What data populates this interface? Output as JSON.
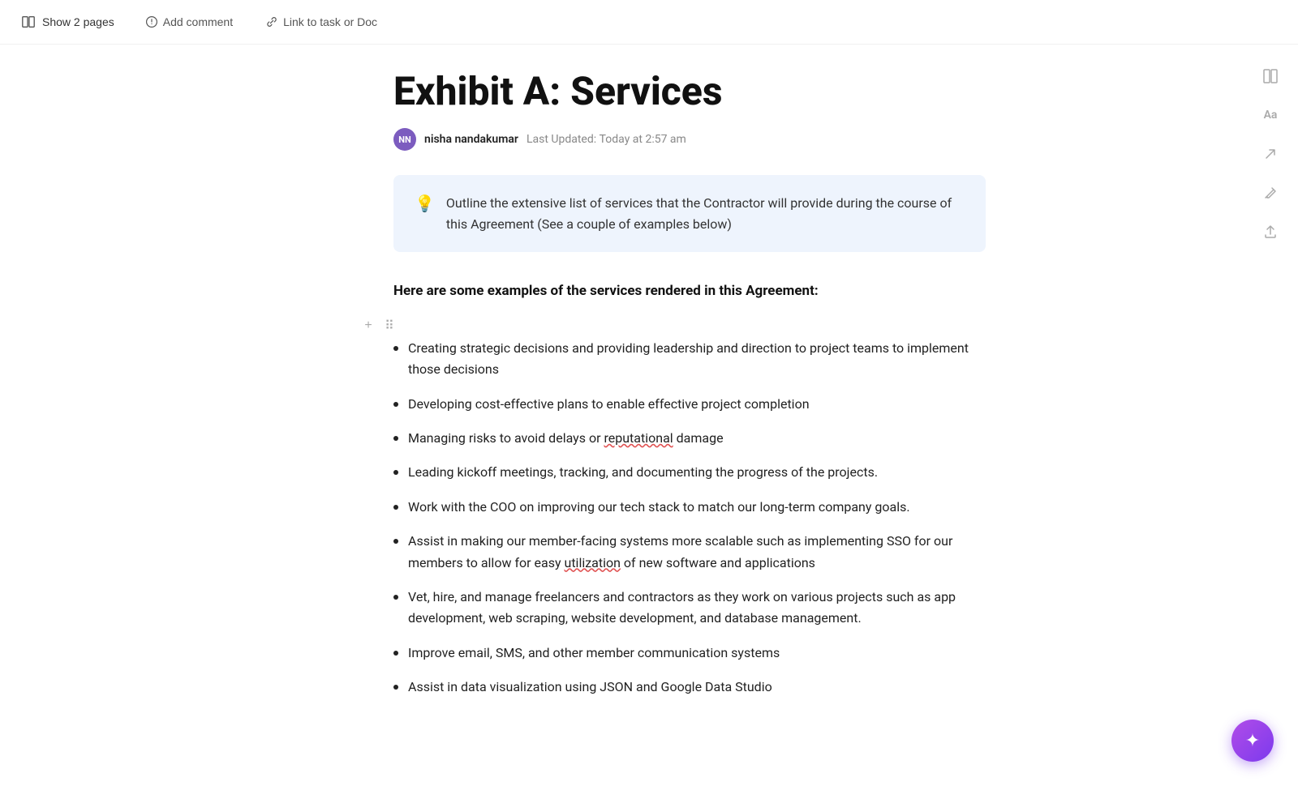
{
  "toolbar": {
    "show_pages_label": "Show 2 pages",
    "add_comment_label": "Add comment",
    "link_task_label": "Link to task or Doc"
  },
  "right_sidebar": {
    "icons": [
      {
        "name": "layout-icon",
        "symbol": "⊞"
      },
      {
        "name": "font-icon",
        "symbol": "Aa"
      },
      {
        "name": "share-icon",
        "symbol": "↗"
      },
      {
        "name": "edit-icon",
        "symbol": "✎"
      },
      {
        "name": "export-icon",
        "symbol": "↑"
      }
    ]
  },
  "document": {
    "title": "Exhibit A: Services",
    "author": {
      "initials": "NN",
      "name": "nisha nandakumar",
      "last_updated_label": "Last Updated:",
      "last_updated_value": "Today at 2:57 am"
    },
    "callout": {
      "icon": "💡",
      "text": "Outline the extensive list of services that the Contractor will provide during the course of this Agreement (See a couple of examples below)"
    },
    "section_heading": "Here are some examples of the services rendered in this Agreement:",
    "bullet_items": [
      {
        "id": 1,
        "text": "Creating strategic decisions and providing leadership and direction to project teams to implement those decisions",
        "underline_word": null
      },
      {
        "id": 2,
        "text": "Developing cost-effective plans to enable effective project completion",
        "underline_word": null
      },
      {
        "id": 3,
        "text": "Managing risks to avoid delays or reputational damage",
        "underline_word": "reputational"
      },
      {
        "id": 4,
        "text": "Leading kickoff meetings, tracking, and documenting the progress of the projects.",
        "underline_word": null
      },
      {
        "id": 5,
        "text": "Work with the COO on improving our tech stack to match our long-term company goals.",
        "underline_word": null
      },
      {
        "id": 6,
        "text": "Assist in making our member-facing systems more scalable such as implementing SSO for our members to allow for easy utilization of new software and applications",
        "underline_word": "utilization"
      },
      {
        "id": 7,
        "text": "Vet, hire, and manage freelancers and contractors as they work on various projects such as app development, web scraping, website development, and database management.",
        "underline_word": null
      },
      {
        "id": 8,
        "text": "Improve email, SMS, and other member communication systems",
        "underline_word": null
      },
      {
        "id": 9,
        "text": "Assist in data visualization using JSON and Google Data Studio",
        "underline_word": null
      }
    ]
  },
  "fab": {
    "symbol": "✦",
    "label": "AI Assistant"
  }
}
